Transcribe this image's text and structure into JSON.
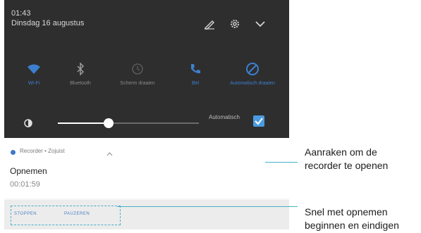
{
  "status": {
    "time": "01:43",
    "date": "Dinsdag 16 augustus"
  },
  "header_icons": [
    "edit-icon",
    "gear-icon",
    "chevron-down-icon"
  ],
  "toggles": [
    {
      "label": "Wi-Fi",
      "icon": "wifi-icon",
      "active": true
    },
    {
      "label": "Bluetooth",
      "icon": "bluetooth-icon",
      "active": false
    },
    {
      "label": "Scherm draaien",
      "icon": "rotate-icon",
      "active": false
    },
    {
      "label": "Bel",
      "icon": "call-icon",
      "active": true
    },
    {
      "label": "Automatisch draaien",
      "icon": "auto-rotate-icon",
      "active": true
    }
  ],
  "brightness": {
    "level": 0.36,
    "auto_label": "Automatisch",
    "auto_checked": true
  },
  "notification": {
    "app_line": "Recorder • Zojuist",
    "title": "Opnemen",
    "elapsed": "00:01:59",
    "actions": [
      "STOPPEN",
      "PAUZEREN"
    ]
  },
  "callouts": {
    "first": "Aanraken om de recorder te openen",
    "first_line1": "Aanraken om de",
    "first_line2": "recorder te openen",
    "second_line1": "Snel met opnemen",
    "second_line2": "beginnen en eindigen"
  },
  "colors": {
    "accent": "#3d7fcf",
    "callout_line": "#47b0c8",
    "panel_bg": "#2e2e2e"
  }
}
